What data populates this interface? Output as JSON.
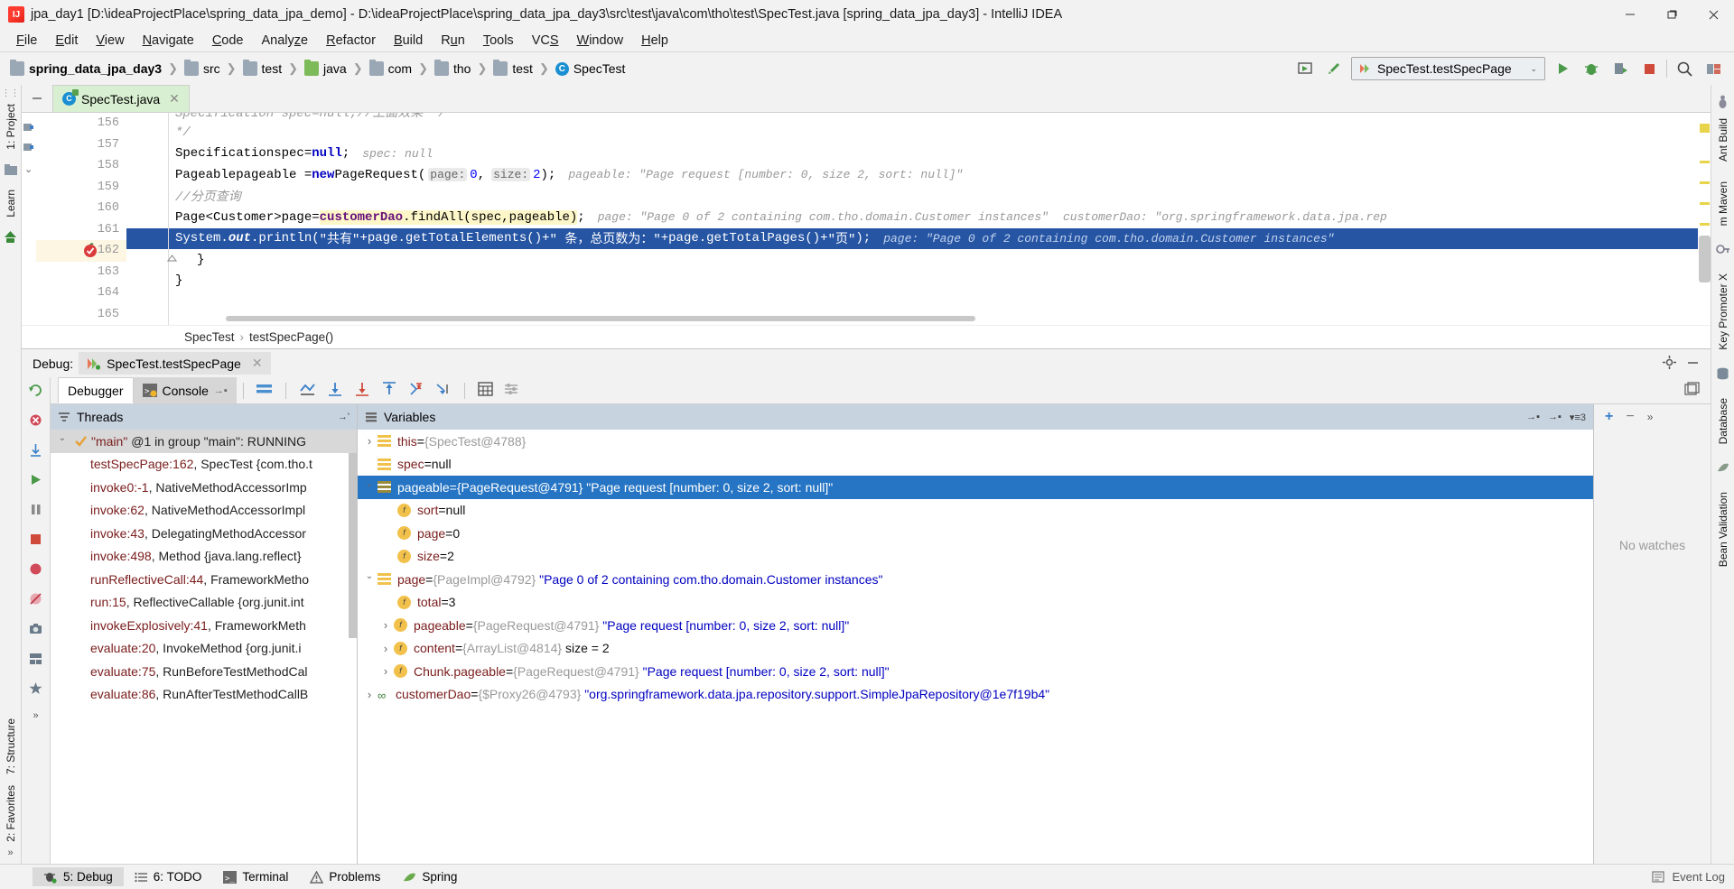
{
  "window": {
    "title": "jpa_day1 [D:\\ideaProjectPlace\\spring_data_jpa_demo] - D:\\ideaProjectPlace\\spring_data_jpa_day3\\src\\test\\java\\com\\tho\\test\\SpecTest.java [spring_data_jpa_day3] - IntelliJ IDEA",
    "app_icon": "IJ",
    "minimize": "–",
    "maximize": "❐",
    "close": "✕"
  },
  "menu": [
    {
      "label": "File"
    },
    {
      "label": "Edit"
    },
    {
      "label": "View"
    },
    {
      "label": "Navigate"
    },
    {
      "label": "Code"
    },
    {
      "label": "Analyze"
    },
    {
      "label": "Refactor"
    },
    {
      "label": "Build"
    },
    {
      "label": "Run"
    },
    {
      "label": "Tools"
    },
    {
      "label": "VCS"
    },
    {
      "label": "Window"
    },
    {
      "label": "Help"
    }
  ],
  "breadcrumbs": [
    {
      "label": "spring_data_jpa_day3",
      "icon": "folder-icon",
      "bold": true,
      "color": "grey"
    },
    {
      "label": "src",
      "icon": "folder-icon",
      "color": "grey"
    },
    {
      "label": "test",
      "icon": "folder-icon",
      "color": "grey"
    },
    {
      "label": "java",
      "icon": "folder-icon",
      "color": "green"
    },
    {
      "label": "com",
      "icon": "folder-icon",
      "color": "grey"
    },
    {
      "label": "tho",
      "icon": "folder-icon",
      "color": "grey"
    },
    {
      "label": "test",
      "icon": "folder-icon",
      "color": "grey"
    },
    {
      "label": "SpecTest",
      "icon": "java-class-icon",
      "color": "class"
    }
  ],
  "toolbar": {
    "run_config": "SpecTest.testSpecPage",
    "run_config_chevron": "⌄",
    "icons": [
      "build-icon",
      "hammer-icon",
      "run-icon",
      "debug-icon",
      "run-coverage-icon",
      "stop-icon",
      "search-icon",
      "project-structure-icon"
    ]
  },
  "editor": {
    "tab": {
      "label": "SpecTest.java",
      "icon": "java-class-icon",
      "close": "✕"
    },
    "breadcrumb": [
      "SpecTest",
      "testSpecPage()"
    ],
    "breadcrumb_sep": "›",
    "lines": [
      {
        "no": "156",
        "kind": "comment-partial",
        "text": "Specification spec=null;//上面效果  */"
      },
      {
        "no": "157",
        "kind": "comment",
        "text": "*/"
      },
      {
        "no": "158",
        "kind": "code"
      },
      {
        "no": "159",
        "kind": "code"
      },
      {
        "no": "160",
        "kind": "comment",
        "text": "//分页查询"
      },
      {
        "no": "161",
        "kind": "code"
      },
      {
        "no": "162",
        "kind": "code",
        "current": true,
        "breakpoint": true
      },
      {
        "no": "163",
        "kind": "code",
        "text": "}"
      },
      {
        "no": "164",
        "kind": "code",
        "text": "}"
      },
      {
        "no": "165",
        "kind": "code",
        "text": ""
      }
    ],
    "line158": {
      "type": "Specification",
      "var": " spec=",
      "kw": "null",
      "semi": ";",
      "hint": "spec: null"
    },
    "line159": {
      "type": "Pageable",
      "var": " pageable = ",
      "kw": "new",
      "ctor": " PageRequest(",
      "p1": "page:",
      "v1": "0",
      "comma": ",",
      "p2": "size:",
      "v2": "2",
      "close": ");",
      "hint": "pageable:  \"Page request [number: 0, size 2, sort: null]\""
    },
    "line161": {
      "type": "Page<Customer>",
      "var": " page= ",
      "field": "customerDao",
      "call": ".findAll(spec,pageable)",
      "semi": ";",
      "hint1": "page:  \"Page 0 of 2 containing com.tho.domain.Customer instances\"",
      "hint2": "customerDao:  \"org.springframework.data.jpa.rep"
    },
    "line162": {
      "sys": "System.",
      "out": "out",
      "println": ".println(",
      "s1": "\"共有\"",
      "plus1": "+page.getTotalElements()+",
      "s2": "\" 条，总页数为：\"",
      "plus2": "+page.getTotalPages()+",
      "s3": "\"页\"",
      "close": ");",
      "hint": "page:  \"Page 0 of 2 containing com.tho.domain.Customer instances\""
    }
  },
  "debug": {
    "label": "Debug:",
    "session_tab": "SpecTest.testSpecPage",
    "session_close": "✕",
    "settings_icon": "gear-icon",
    "minimize_icon": "minimize-icon",
    "tabs": [
      {
        "label": "Debugger",
        "active": true,
        "icon": null
      },
      {
        "label": "Console",
        "active": false,
        "icon": "console-icon",
        "pin": "→▪"
      }
    ],
    "tool_icons": [
      "mute-breakpoints-icon",
      "restore-layout-icon",
      "step-over-icon",
      "step-into-icon",
      "force-step-into-icon",
      "step-out-icon",
      "drop-frame-icon",
      "run-to-cursor-icon",
      "evaluate-expression-icon",
      "settings-icon"
    ],
    "side_rail_icons": [
      "rerun-icon",
      "rerun-failed-icon",
      "resume-icon",
      "pause-icon",
      "stop-icon",
      "view-breakpoints-icon",
      "mute-breakpoints-icon",
      "camera-icon",
      "layout-icon",
      "more-icon"
    ],
    "threads": {
      "title": "Threads",
      "title_icon": "threads-icon",
      "pin_icon": "→'",
      "head": {
        "quote": "\"main\"",
        "rest": "@1 in group \"main\": RUNNING",
        "icon": "check-icon"
      },
      "frames": [
        {
          "method": "testSpecPage:162",
          "rest": ", SpecTest {com.tho.t"
        },
        {
          "method": "invoke0:-1",
          "rest": ", NativeMethodAccessorImp"
        },
        {
          "method": "invoke:62",
          "rest": ", NativeMethodAccessorImpl"
        },
        {
          "method": "invoke:43",
          "rest": ", DelegatingMethodAccessor"
        },
        {
          "method": "invoke:498",
          "rest": ", Method {java.lang.reflect}"
        },
        {
          "method": "runReflectiveCall:44",
          "rest": ", FrameworkMetho"
        },
        {
          "method": "run:15",
          "rest": ", ReflectiveCallable {org.junit.int"
        },
        {
          "method": "invokeExplosively:41",
          "rest": ", FrameworkMeth"
        },
        {
          "method": "evaluate:20",
          "rest": ", InvokeMethod {org.junit.i"
        },
        {
          "method": "evaluate:75",
          "rest": ", RunBeforeTestMethodCal"
        },
        {
          "method": "evaluate:86",
          "rest": ", RunAfterTestMethodCallB"
        }
      ]
    },
    "variables": {
      "title": "Variables",
      "title_icon": "variables-icon",
      "right_icons": [
        "pin-icon",
        "settings-icon",
        "list-icon"
      ],
      "badge": "3",
      "rows": [
        {
          "indent": 0,
          "arrow": "closed",
          "icon": "local-var-icon",
          "name": "this",
          "eq": " = ",
          "ref": "{SpecTest@4788}",
          "str": "",
          "val": ""
        },
        {
          "indent": 0,
          "arrow": "none",
          "icon": "local-var-icon",
          "name": "spec",
          "eq": " = ",
          "ref": "",
          "str": "",
          "val": "null"
        },
        {
          "indent": 0,
          "arrow": "open",
          "icon": "local-var-olive-icon",
          "name": "pageable",
          "eq": " = ",
          "ref": "{PageRequest@4791}",
          "str": "\"Page request [number: 0, size 2, sort: null]\"",
          "val": "",
          "selected": true
        },
        {
          "indent": 1,
          "arrow": "none",
          "icon": "field-icon",
          "name": "sort",
          "eq": " = ",
          "ref": "",
          "str": "",
          "val": "null"
        },
        {
          "indent": 1,
          "arrow": "none",
          "icon": "field-icon",
          "name": "page",
          "eq": " = ",
          "ref": "",
          "str": "",
          "val": "0"
        },
        {
          "indent": 1,
          "arrow": "none",
          "icon": "field-icon",
          "name": "size",
          "eq": " = ",
          "ref": "",
          "str": "",
          "val": "2"
        },
        {
          "indent": 0,
          "arrow": "open",
          "icon": "local-var-icon",
          "name": "page",
          "eq": " = ",
          "ref": "{PageImpl@4792}",
          "str": "\"Page 0 of 2 containing com.tho.domain.Customer instances\"",
          "val": ""
        },
        {
          "indent": 1,
          "arrow": "none",
          "icon": "field-icon",
          "name": "total",
          "eq": " = ",
          "ref": "",
          "str": "",
          "val": "3"
        },
        {
          "indent": 1,
          "arrow": "closed",
          "icon": "field-icon",
          "name": "pageable",
          "eq": " = ",
          "ref": "{PageRequest@4791}",
          "str": "\"Page request [number: 0, size 2, sort: null]\"",
          "val": ""
        },
        {
          "indent": 1,
          "arrow": "closed",
          "icon": "field-icon",
          "name": "content",
          "eq": " = ",
          "ref": "{ArrayList@4814}",
          "str": "",
          "val": "size = 2"
        },
        {
          "indent": 1,
          "arrow": "closed",
          "icon": "field-icon",
          "name": "Chunk.pageable",
          "eq": " = ",
          "ref": "{PageRequest@4791}",
          "str": "\"Page request [number: 0, size 2, sort: null]\"",
          "val": ""
        },
        {
          "indent": 0,
          "arrow": "closed",
          "icon": "object-icon",
          "name": "customerDao",
          "eq": " = ",
          "ref": "{$Proxy26@4793}",
          "str": "\"org.springframework.data.jpa.repository.support.SimpleJpaRepository@1e7f19b4\"",
          "val": ""
        }
      ]
    },
    "watches": {
      "empty_text": "No watches",
      "add_icon": "+",
      "remove_icon": "−",
      "more_icon": "»"
    }
  },
  "left_rail": {
    "items": [
      {
        "label": "1: Project",
        "selected": false
      },
      {
        "label": "Learn",
        "selected": false
      },
      {
        "label": "2: Favorites",
        "selected": false
      },
      {
        "label": "7: Structure",
        "selected": false
      }
    ],
    "bottom_more": "»"
  },
  "right_rail": {
    "items": [
      {
        "label": "Ant Build"
      },
      {
        "label": "m  Maven"
      },
      {
        "label": "Key Promoter X"
      },
      {
        "label": "Database"
      },
      {
        "label": "Bean Validation"
      }
    ]
  },
  "statusbar": {
    "items": [
      {
        "label": "5: Debug",
        "icon": "debug-icon",
        "active": true
      },
      {
        "label": "6: TODO",
        "icon": "todo-icon",
        "active": false
      },
      {
        "label": "Terminal",
        "icon": "terminal-icon",
        "active": false
      },
      {
        "label": "Problems",
        "icon": "problems-icon",
        "active": false
      },
      {
        "label": "Spring",
        "icon": "spring-leaf-icon",
        "active": false
      }
    ],
    "right": {
      "event_log": "Event Log",
      "event_log_icon": "event-log-icon"
    }
  },
  "colors": {
    "selection_blue": "#2675c4",
    "editor_current_line": "#2655a4",
    "pane_header": "#c8d3e0",
    "tab_green": "#d9efd1",
    "breakpoint_red": "#db3b3b"
  }
}
